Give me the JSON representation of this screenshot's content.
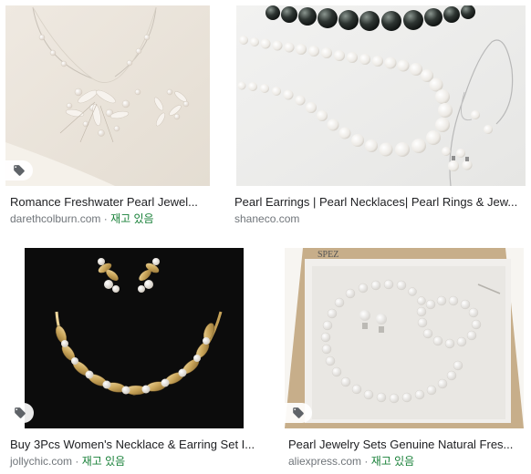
{
  "results": [
    {
      "title": "Romance Freshwater Pearl Jewel...",
      "source": "darethcolburn.com",
      "separator": " · ",
      "stock": "재고 있음",
      "badge_icon": "tag-icon"
    },
    {
      "title": "Pearl Earrings | Pearl Necklaces| Pearl Rings & Jew...",
      "source": "shaneco.com",
      "separator": "",
      "stock": "",
      "badge_icon": ""
    },
    {
      "title": "Buy 3Pcs Women's Necklace & Earring Set I...",
      "source": "jollychic.com",
      "separator": " · ",
      "stock": "재고 있음",
      "badge_icon": "tag-icon"
    },
    {
      "title": "Pearl Jewelry Sets Genuine Natural Fres...",
      "source": "aliexpress.com",
      "separator": " · ",
      "stock": "재고 있음",
      "badge_icon": "tag-icon",
      "box_brand": "SPEZ"
    }
  ],
  "colors": {
    "title": "#202124",
    "source": "#70757a",
    "stock": "#188038"
  }
}
